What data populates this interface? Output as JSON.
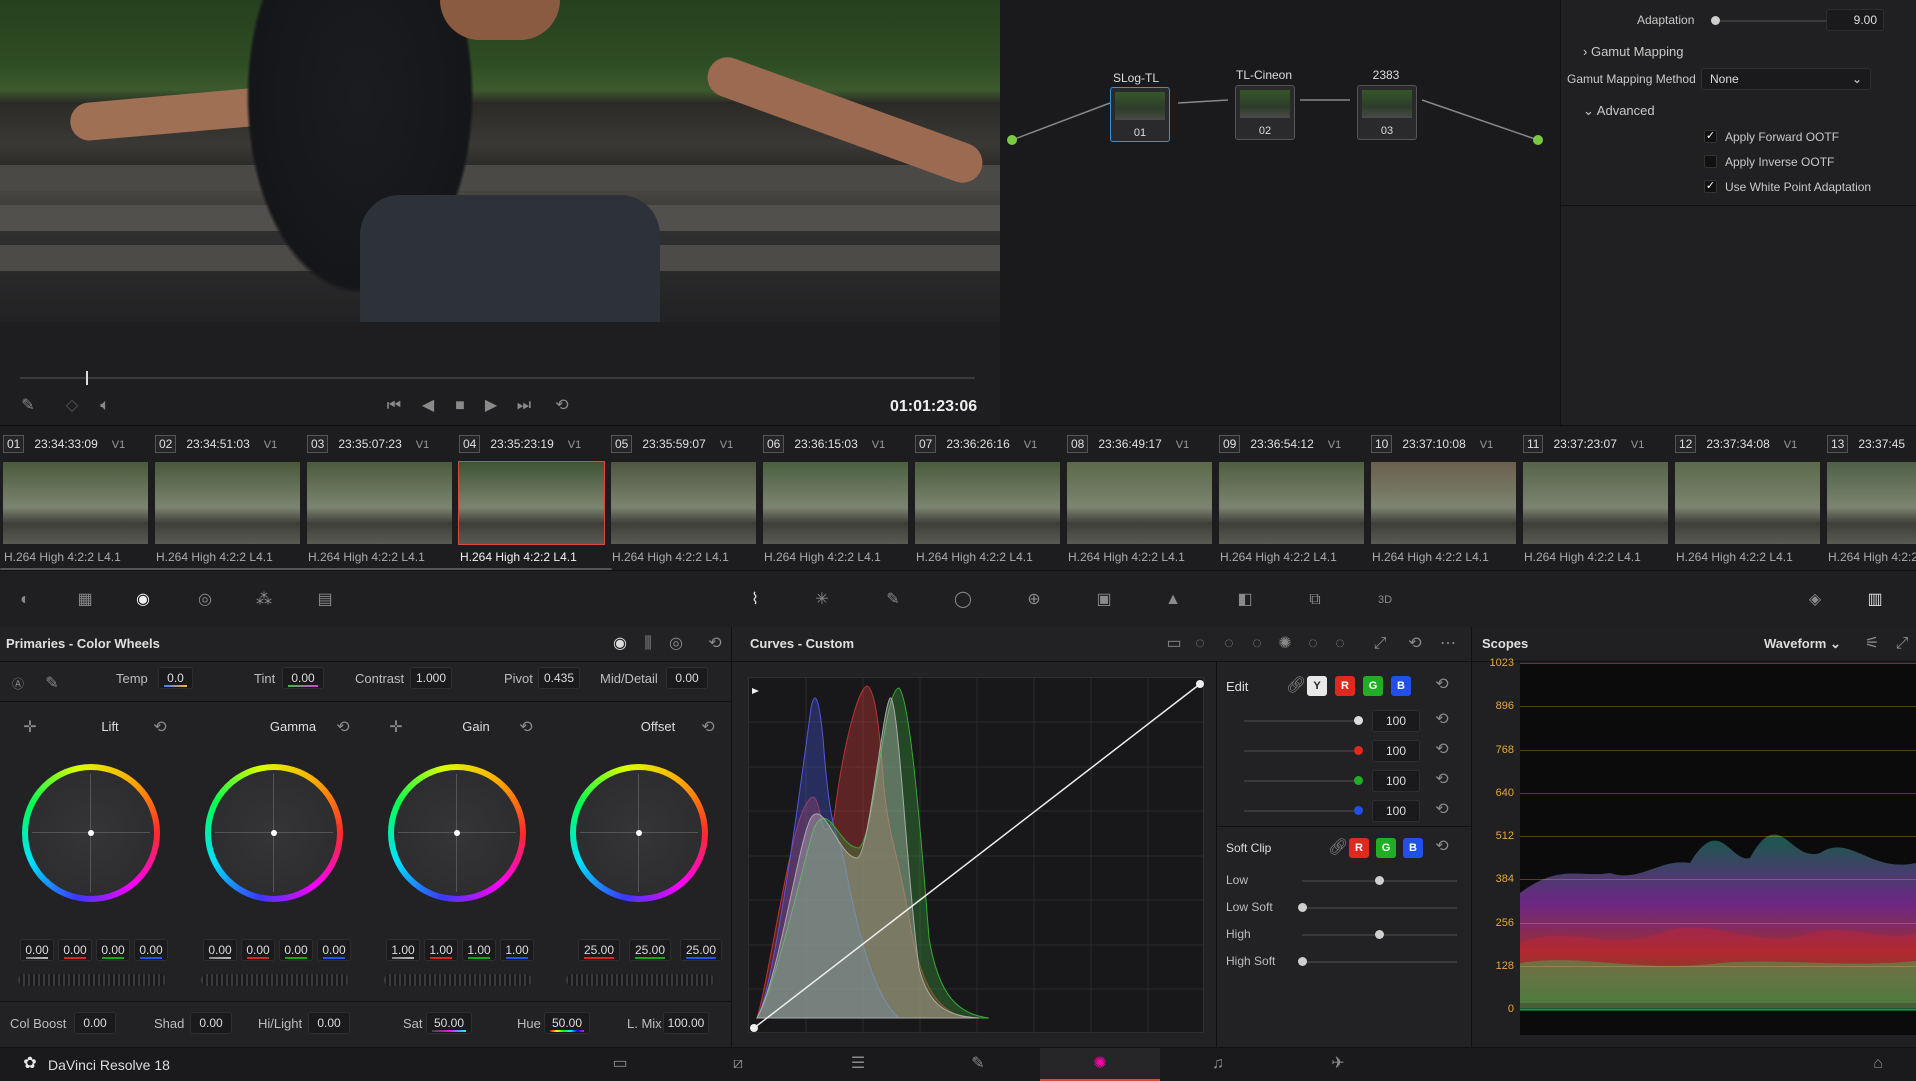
{
  "viewer": {
    "timecode": "01:01:23:06"
  },
  "node_graph": {
    "nodes": [
      {
        "label": "SLog-TL",
        "num": "01"
      },
      {
        "label": "TL-Cineon",
        "num": "02"
      },
      {
        "label": "2383",
        "num": "03"
      }
    ]
  },
  "right_panel": {
    "adaptation_label": "Adaptation",
    "adaptation_value": "9.00",
    "gamut_mapping": "Gamut Mapping",
    "gamut_method_label": "Gamut Mapping Method",
    "gamut_method_value": "None",
    "advanced": "Advanced",
    "checks": [
      {
        "label": "Apply Forward OOTF",
        "checked": true
      },
      {
        "label": "Apply Inverse OOTF",
        "checked": false
      },
      {
        "label": "Use White Point Adaptation",
        "checked": true
      }
    ]
  },
  "timeline": {
    "clips": [
      {
        "num": "01",
        "tc": "23:34:33:09",
        "track": "V1",
        "codec": "H.264 High 4:2:2 L4.1"
      },
      {
        "num": "02",
        "tc": "23:34:51:03",
        "track": "V1",
        "codec": "H.264 High 4:2:2 L4.1"
      },
      {
        "num": "03",
        "tc": "23:35:07:23",
        "track": "V1",
        "codec": "H.264 High 4:2:2 L4.1"
      },
      {
        "num": "04",
        "tc": "23:35:23:19",
        "track": "V1",
        "codec": "H.264 High 4:2:2 L4.1"
      },
      {
        "num": "05",
        "tc": "23:35:59:07",
        "track": "V1",
        "codec": "H.264 High 4:2:2 L4.1"
      },
      {
        "num": "06",
        "tc": "23:36:15:03",
        "track": "V1",
        "codec": "H.264 High 4:2:2 L4.1"
      },
      {
        "num": "07",
        "tc": "23:36:26:16",
        "track": "V1",
        "codec": "H.264 High 4:2:2 L4.1"
      },
      {
        "num": "08",
        "tc": "23:36:49:17",
        "track": "V1",
        "codec": "H.264 High 4:2:2 L4.1"
      },
      {
        "num": "09",
        "tc": "23:36:54:12",
        "track": "V1",
        "codec": "H.264 High 4:2:2 L4.1"
      },
      {
        "num": "10",
        "tc": "23:37:10:08",
        "track": "V1",
        "codec": "H.264 High 4:2:2 L4.1"
      },
      {
        "num": "11",
        "tc": "23:37:23:07",
        "track": "V1",
        "codec": "H.264 High 4:2:2 L4.1"
      },
      {
        "num": "12",
        "tc": "23:37:34:08",
        "track": "V1",
        "codec": "H.264 High 4:2:2 L4.1"
      },
      {
        "num": "13",
        "tc": "23:37:45",
        "track": "",
        "codec": "H.264 High 4:2:2"
      }
    ],
    "selected_index": 3
  },
  "primaries": {
    "title": "Primaries - Color Wheels",
    "params": {
      "temp_label": "Temp",
      "temp": "0.0",
      "tint_label": "Tint",
      "tint": "0.00",
      "contrast_label": "Contrast",
      "contrast": "1.000",
      "pivot_label": "Pivot",
      "pivot": "0.435",
      "middetail_label": "Mid/Detail",
      "middetail": "0.00"
    },
    "wheels": [
      {
        "name": "Lift",
        "values": [
          "0.00",
          "0.00",
          "0.00",
          "0.00"
        ]
      },
      {
        "name": "Gamma",
        "values": [
          "0.00",
          "0.00",
          "0.00",
          "0.00"
        ]
      },
      {
        "name": "Gain",
        "values": [
          "1.00",
          "1.00",
          "1.00",
          "1.00"
        ]
      },
      {
        "name": "Offset",
        "values": [
          "25.00",
          "25.00",
          "25.00"
        ]
      }
    ],
    "bottom": {
      "colboost_label": "Col Boost",
      "colboost": "0.00",
      "shad_label": "Shad",
      "shad": "0.00",
      "hilight_label": "Hi/Light",
      "hilight": "0.00",
      "sat_label": "Sat",
      "sat": "50.00",
      "hue_label": "Hue",
      "hue": "50.00",
      "lmix_label": "L. Mix",
      "lmix": "100.00"
    }
  },
  "curves": {
    "title": "Curves - Custom",
    "edit_label": "Edit",
    "channels": [
      "Y",
      "R",
      "G",
      "B"
    ],
    "edit_values": [
      "100",
      "100",
      "100",
      "100"
    ],
    "softclip_label": "Soft Clip",
    "softclip_channels": [
      "R",
      "G",
      "B"
    ],
    "softclip_rows": [
      "Low",
      "Low Soft",
      "High",
      "High Soft"
    ]
  },
  "scopes": {
    "title": "Scopes",
    "mode": "Waveform",
    "ticks": [
      "1023",
      "896",
      "768",
      "640",
      "512",
      "384",
      "256",
      "128",
      "0"
    ]
  },
  "app": {
    "name": "DaVinci Resolve 18"
  },
  "colors": {
    "accent_red": "#e0453b",
    "selected_page": "#e0453b",
    "scope_tick": "#e8a53a"
  }
}
